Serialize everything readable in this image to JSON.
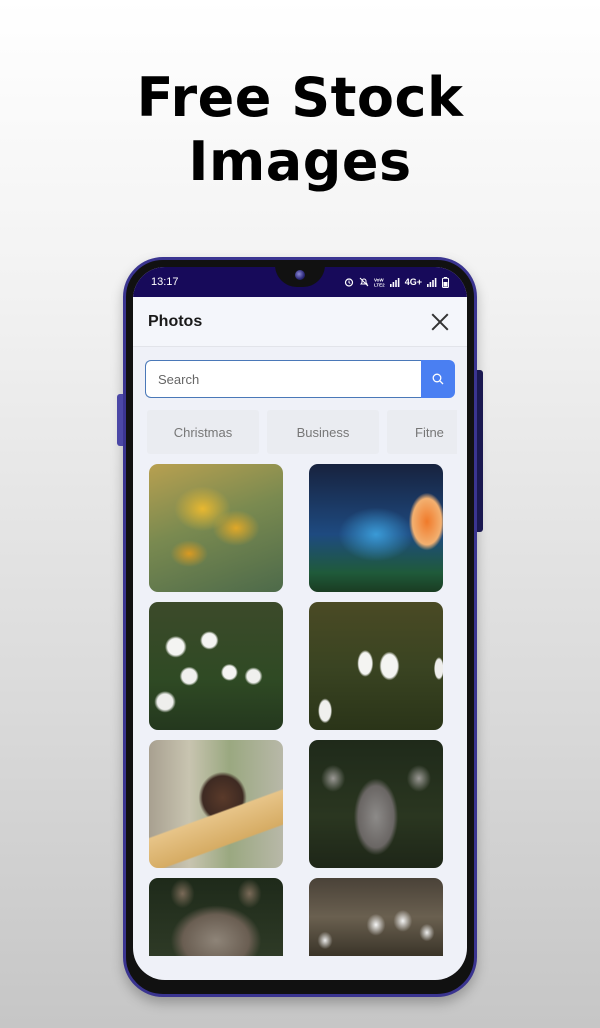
{
  "headline": {
    "line1": "Free Stock",
    "line2": "Images"
  },
  "status_bar": {
    "time": "13:17",
    "icons": [
      "alarm-icon",
      "mute-icon",
      "volte-icon",
      "signal-icon",
      "4g-icon",
      "signal-icon",
      "battery-icon"
    ],
    "network_label": "4G+",
    "volte_label": "VoLTE"
  },
  "app": {
    "title": "Photos",
    "close_label": "Close",
    "search": {
      "placeholder": "Search",
      "value": ""
    },
    "categories": [
      {
        "label": "Christmas"
      },
      {
        "label": "Business"
      },
      {
        "label": "Fitne"
      }
    ],
    "photos": [
      {
        "subject": "Yellow crocus flowers"
      },
      {
        "subject": "Orange tulip on blue background"
      },
      {
        "subject": "Snowdrop flowers"
      },
      {
        "subject": "Snowdrop flowers close-up"
      },
      {
        "subject": "Squirrel on bird feeder"
      },
      {
        "subject": "Deer portrait"
      },
      {
        "subject": "Wolf portrait"
      },
      {
        "subject": "White cherry blossoms"
      }
    ]
  },
  "colors": {
    "status_bar": "#170a5a",
    "accent_blue": "#4a7ff2",
    "phone_frame": "#3a3490"
  }
}
